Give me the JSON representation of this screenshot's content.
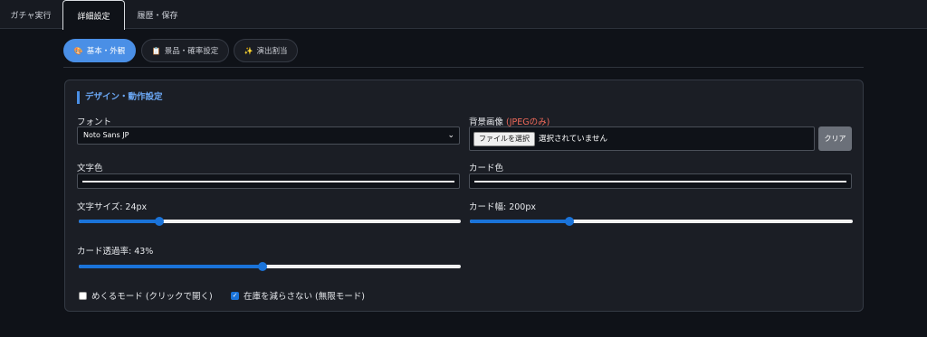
{
  "nav": {
    "tabs": [
      {
        "label": "ガチャ実行",
        "active": false
      },
      {
        "label": "詳細設定",
        "active": true
      },
      {
        "label": "履歴・保存",
        "active": false
      }
    ]
  },
  "subtabs": [
    {
      "icon": "🎨",
      "label": "基本・外観",
      "active": true
    },
    {
      "icon": "📋",
      "label": "景品・確率設定",
      "active": false
    },
    {
      "icon": "✨",
      "label": "演出割当",
      "active": false
    }
  ],
  "design": {
    "title": "デザイン・動作設定",
    "font_label": "フォント",
    "font_value": "Noto Sans JP",
    "bg_label": "背景画像",
    "bg_label_note": "(JPEGのみ)",
    "file_button": "ファイルを選択",
    "file_status": "選択されていません",
    "clear_button": "クリア",
    "text_color_label": "文字色",
    "card_color_label": "カード色",
    "text_color": "#e8e8e8",
    "card_color": "#e8e8e8",
    "text_size_label": "文字サイズ: 24px",
    "text_size_fraction": 0.21,
    "card_width_label": "カード幅: 200px",
    "card_width_fraction": 0.26,
    "opacity_label": "カード透過率: 43%",
    "opacity_fraction": 0.48,
    "flip_mode_label": "めくるモード (クリックで開く)",
    "flip_mode_checked": false,
    "infinite_label": "在庫を減らさない (無限モード)",
    "infinite_checked": true
  },
  "colors": {
    "accent": "#4a8fe6",
    "slider": "#1a73d9",
    "note_red": "#f06a5a"
  }
}
